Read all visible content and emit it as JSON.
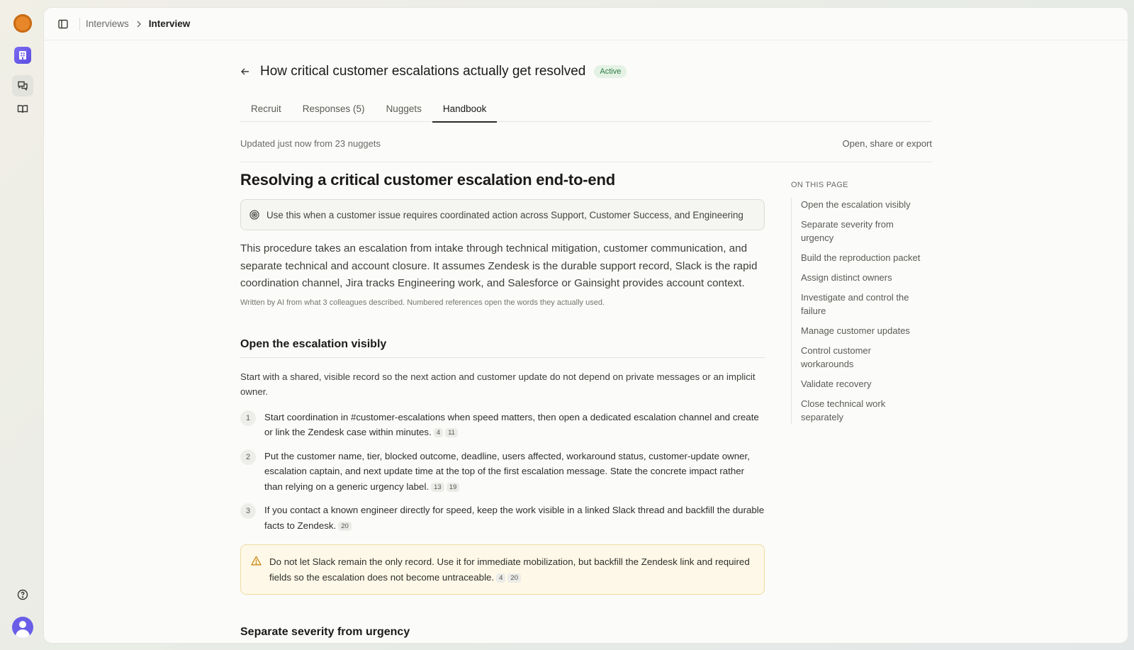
{
  "breadcrumb": {
    "parent": "Interviews",
    "current": "Interview"
  },
  "interview": {
    "title": "How critical customer escalations actually get resolved",
    "status": "Active"
  },
  "tabs": [
    {
      "label": "Recruit"
    },
    {
      "label": "Responses (5)"
    },
    {
      "label": "Nuggets"
    },
    {
      "label": "Handbook"
    }
  ],
  "meta": {
    "updated": "Updated just now from 23 nuggets",
    "actions": "Open, share or export"
  },
  "doc": {
    "title": "Resolving a critical customer escalation end-to-end",
    "use_case": "Use this when a customer issue requires coordinated action across Support, Customer Success, and Engineering",
    "intro": "This procedure takes an escalation from intake through technical mitigation, customer communication, and separate technical and account closure. It assumes Zendesk is the durable support record, Slack is the rapid coordination channel, Jira tracks Engineering work, and Salesforce or Gainsight provides account context.",
    "ai_note": "Written by AI from what 3 colleagues described. Numbered references open the words they actually used.",
    "section1": {
      "heading": "Open the escalation visibly",
      "lead": "Start with a shared, visible record so the next action and customer update do not depend on private messages or an implicit owner.",
      "steps": [
        {
          "n": "1",
          "text": "Start coordination in #customer-escalations when speed matters, then open a dedicated escalation channel and create or link the Zendesk case within minutes.",
          "r1": "4",
          "r2": "11"
        },
        {
          "n": "2",
          "text": "Put the customer name, tier, blocked outcome, deadline, users affected, workaround status, customer-update owner, escalation captain, and next update time at the top of the first escalation message. State the concrete impact rather than relying on a generic urgency label.",
          "r1": "13",
          "r2": "19"
        },
        {
          "n": "3",
          "text": "If you contact a known engineer directly for speed, keep the work visible in a linked Slack thread and backfill the durable facts to Zendesk.",
          "r1": "20"
        }
      ],
      "warning": {
        "text": "Do not let Slack remain the only record. Use it for immediate mobilization, but backfill the Zendesk link and required fields so the escalation does not become untraceable.",
        "r1": "4",
        "r2": "20"
      }
    },
    "section2": {
      "heading": "Separate severity from urgency"
    }
  },
  "toc": {
    "title": "ON THIS PAGE",
    "items": [
      "Open the escalation visibly",
      "Separate severity from urgency",
      "Build the reproduction packet",
      "Assign distinct owners",
      "Investigate and control the failure",
      "Manage customer updates",
      "Control customer workarounds",
      "Validate recovery",
      "Close technical work separately"
    ]
  },
  "icons": {
    "logo": "app-logo-icon",
    "workspace": "workspace-icon",
    "interviews": "chat-bubbles-icon",
    "handbook": "book-icon",
    "help": "help-circle-icon",
    "sidebar_toggle": "sidebar-toggle-icon",
    "back": "arrow-left-icon",
    "target": "target-icon",
    "warning": "warning-triangle-icon"
  },
  "colors": {
    "active_badge_bg": "#e3f2e4",
    "active_badge_text": "#2f7a43",
    "warning_bg": "#fdf8e8",
    "warning_border": "#efdca3",
    "logo_orange": "#e8862a",
    "workspace_purple": "#6a5ee8"
  }
}
